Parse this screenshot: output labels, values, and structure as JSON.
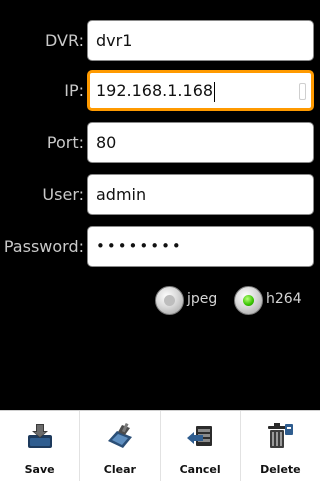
{
  "form": {
    "dvr": {
      "label": "DVR:",
      "value": "dvr1"
    },
    "ip": {
      "label": "IP:",
      "value": "192.168.1.168"
    },
    "port": {
      "label": "Port:",
      "value": "80"
    },
    "user": {
      "label": "User:",
      "value": "admin"
    },
    "password": {
      "label": "Password:",
      "value": "••••••••"
    }
  },
  "stream_format": {
    "options": [
      {
        "label": "jpeg",
        "checked": false
      },
      {
        "label": "h264",
        "checked": true
      }
    ]
  },
  "toolbar": {
    "save_label": "Save",
    "clear_label": "Clear",
    "cancel_label": "Cancel",
    "delete_label": "Delete"
  },
  "colors": {
    "focus_border": "#ff9a00",
    "radio_checked": "#37c400",
    "background": "#000000"
  },
  "icons": {
    "save": "save-icon",
    "clear": "clear-icon",
    "cancel": "cancel-icon",
    "delete": "delete-icon"
  }
}
